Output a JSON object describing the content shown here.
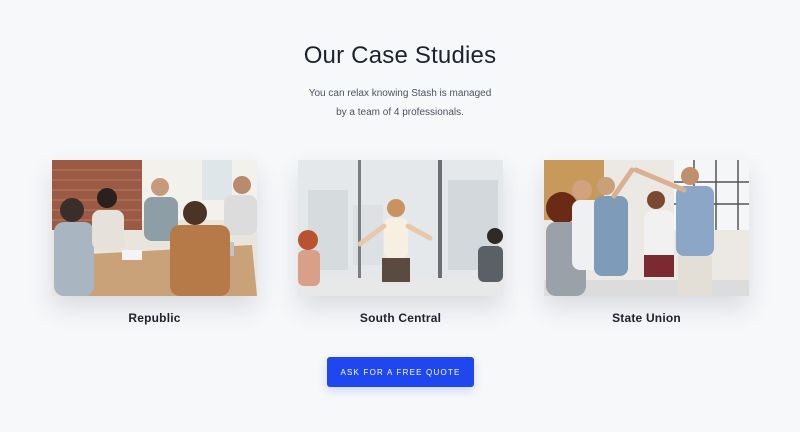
{
  "header": {
    "title": "Our Case Studies",
    "subtitle_line1": "You can relax knowing Stash is managed",
    "subtitle_line2": "by a team of 4 professionals."
  },
  "cases": [
    {
      "label": "Republic",
      "image": "team-meeting-photo"
    },
    {
      "label": "South Central",
      "image": "presentation-photo"
    },
    {
      "label": "State Union",
      "image": "high-five-photo"
    }
  ],
  "cta": {
    "label": "ASK FOR A FREE QUOTE"
  },
  "colors": {
    "background": "#f7f8fa",
    "accent": "#1f47f0",
    "title": "#1e2230",
    "text": "#4b5262"
  }
}
